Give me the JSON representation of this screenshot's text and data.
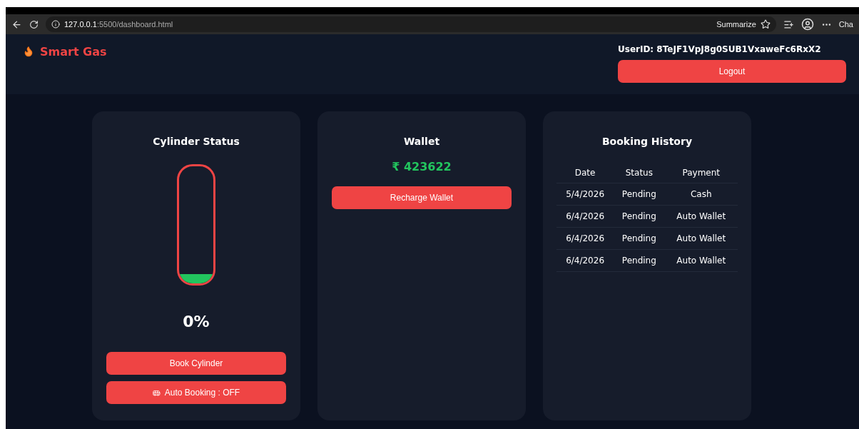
{
  "browser": {
    "url_host": "127.0.0.1",
    "url_path": ":5500/dashboard.html",
    "summarize": "Summarize",
    "copilot": "Cha"
  },
  "header": {
    "brand": "Smart Gas",
    "user_id": "UserID: 8TeJF1VpJ8g0SUB1VxaweFc6RxX2",
    "logout": "Logout"
  },
  "cylinder": {
    "title": "Cylinder Status",
    "level": 0.08,
    "percent": "0%",
    "book_button": "Book Cylinder",
    "auto_button": "Auto Booking : OFF"
  },
  "wallet": {
    "title": "Wallet",
    "balance": "₹ 423622",
    "recharge_button": "Recharge Wallet"
  },
  "history": {
    "title": "Booking History",
    "columns": [
      "Date",
      "Status",
      "Payment"
    ],
    "rows": [
      [
        "5/4/2026",
        "Pending",
        "Cash"
      ],
      [
        "6/4/2026",
        "Pending",
        "Auto Wallet"
      ],
      [
        "6/4/2026",
        "Pending",
        "Auto Wallet"
      ],
      [
        "6/4/2026",
        "Pending",
        "Auto Wallet"
      ]
    ]
  }
}
